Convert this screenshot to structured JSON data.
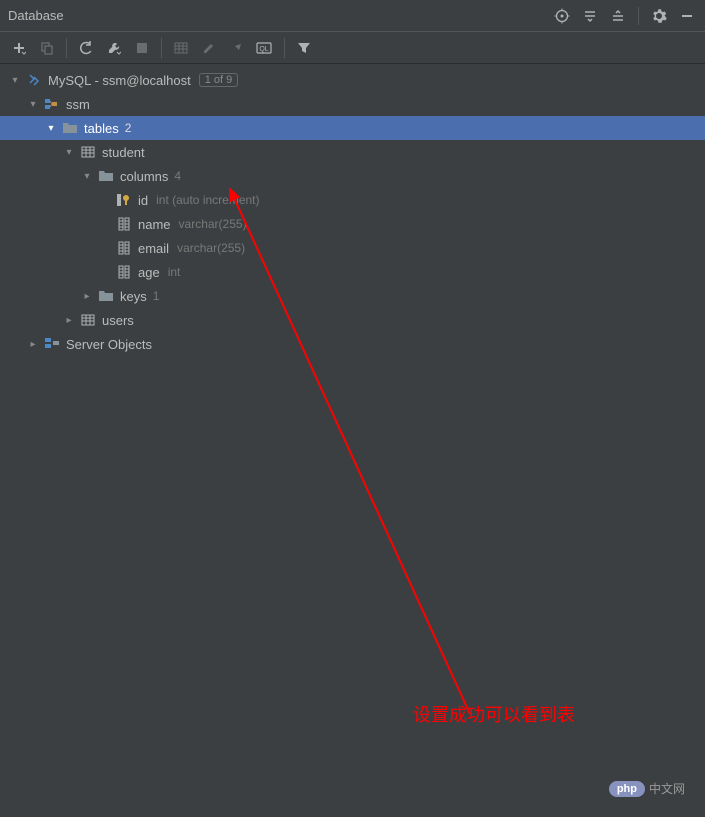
{
  "panel": {
    "title": "Database"
  },
  "toolbar": {
    "add": "add",
    "copy": "copy",
    "refresh": "refresh",
    "wrench": "settings",
    "stop": "stop",
    "table": "table-editor",
    "edit": "edit",
    "jump": "jump",
    "ql": "query-console",
    "filter": "filter"
  },
  "tree": {
    "root": {
      "label": "MySQL - ssm@localhost",
      "badge": "1 of 9",
      "children": {
        "ssm": {
          "label": "ssm",
          "tables": {
            "label": "tables",
            "count": "2",
            "student": {
              "label": "student",
              "columns": {
                "label": "columns",
                "count": "4",
                "id": {
                  "name": "id",
                  "type": "int (auto increment)"
                },
                "name": {
                  "name": "name",
                  "type": "varchar(255)"
                },
                "email": {
                  "name": "email",
                  "type": "varchar(255)"
                },
                "age": {
                  "name": "age",
                  "type": "int"
                }
              },
              "keys": {
                "label": "keys",
                "count": "1"
              }
            },
            "users": {
              "label": "users"
            }
          }
        },
        "server_objects": {
          "label": "Server Objects"
        }
      }
    }
  },
  "annotation": "设置成功可以看到表",
  "watermark": {
    "badge": "php",
    "text": "中文网"
  }
}
